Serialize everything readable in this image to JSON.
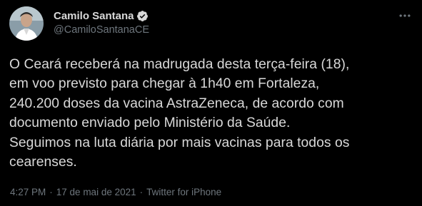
{
  "tweet": {
    "author": {
      "display_name": "Camilo Santana",
      "handle": "@CamiloSantanaCE",
      "avatar_icon": "avatar-photo",
      "verified_icon": "verified-badge-icon"
    },
    "more_icon": "more-options-icon",
    "text": "O Ceará receberá na madrugada desta terça-feira (18),\nem voo previsto para chegar à 1h40 em Fortaleza,\n240.200 doses da vacina AstraZeneca, de acordo com\ndocumento enviado pelo Ministério da Saúde.\nSeguimos na luta diária por mais vacinas para todos os\ncearenses.",
    "time": "4:27 PM",
    "separator": "·",
    "date": "17 de mai de 2021",
    "source": "Twitter for iPhone"
  },
  "colors": {
    "background": "#000000",
    "text": "#d9d9d9",
    "secondary_text": "#6e767d"
  }
}
